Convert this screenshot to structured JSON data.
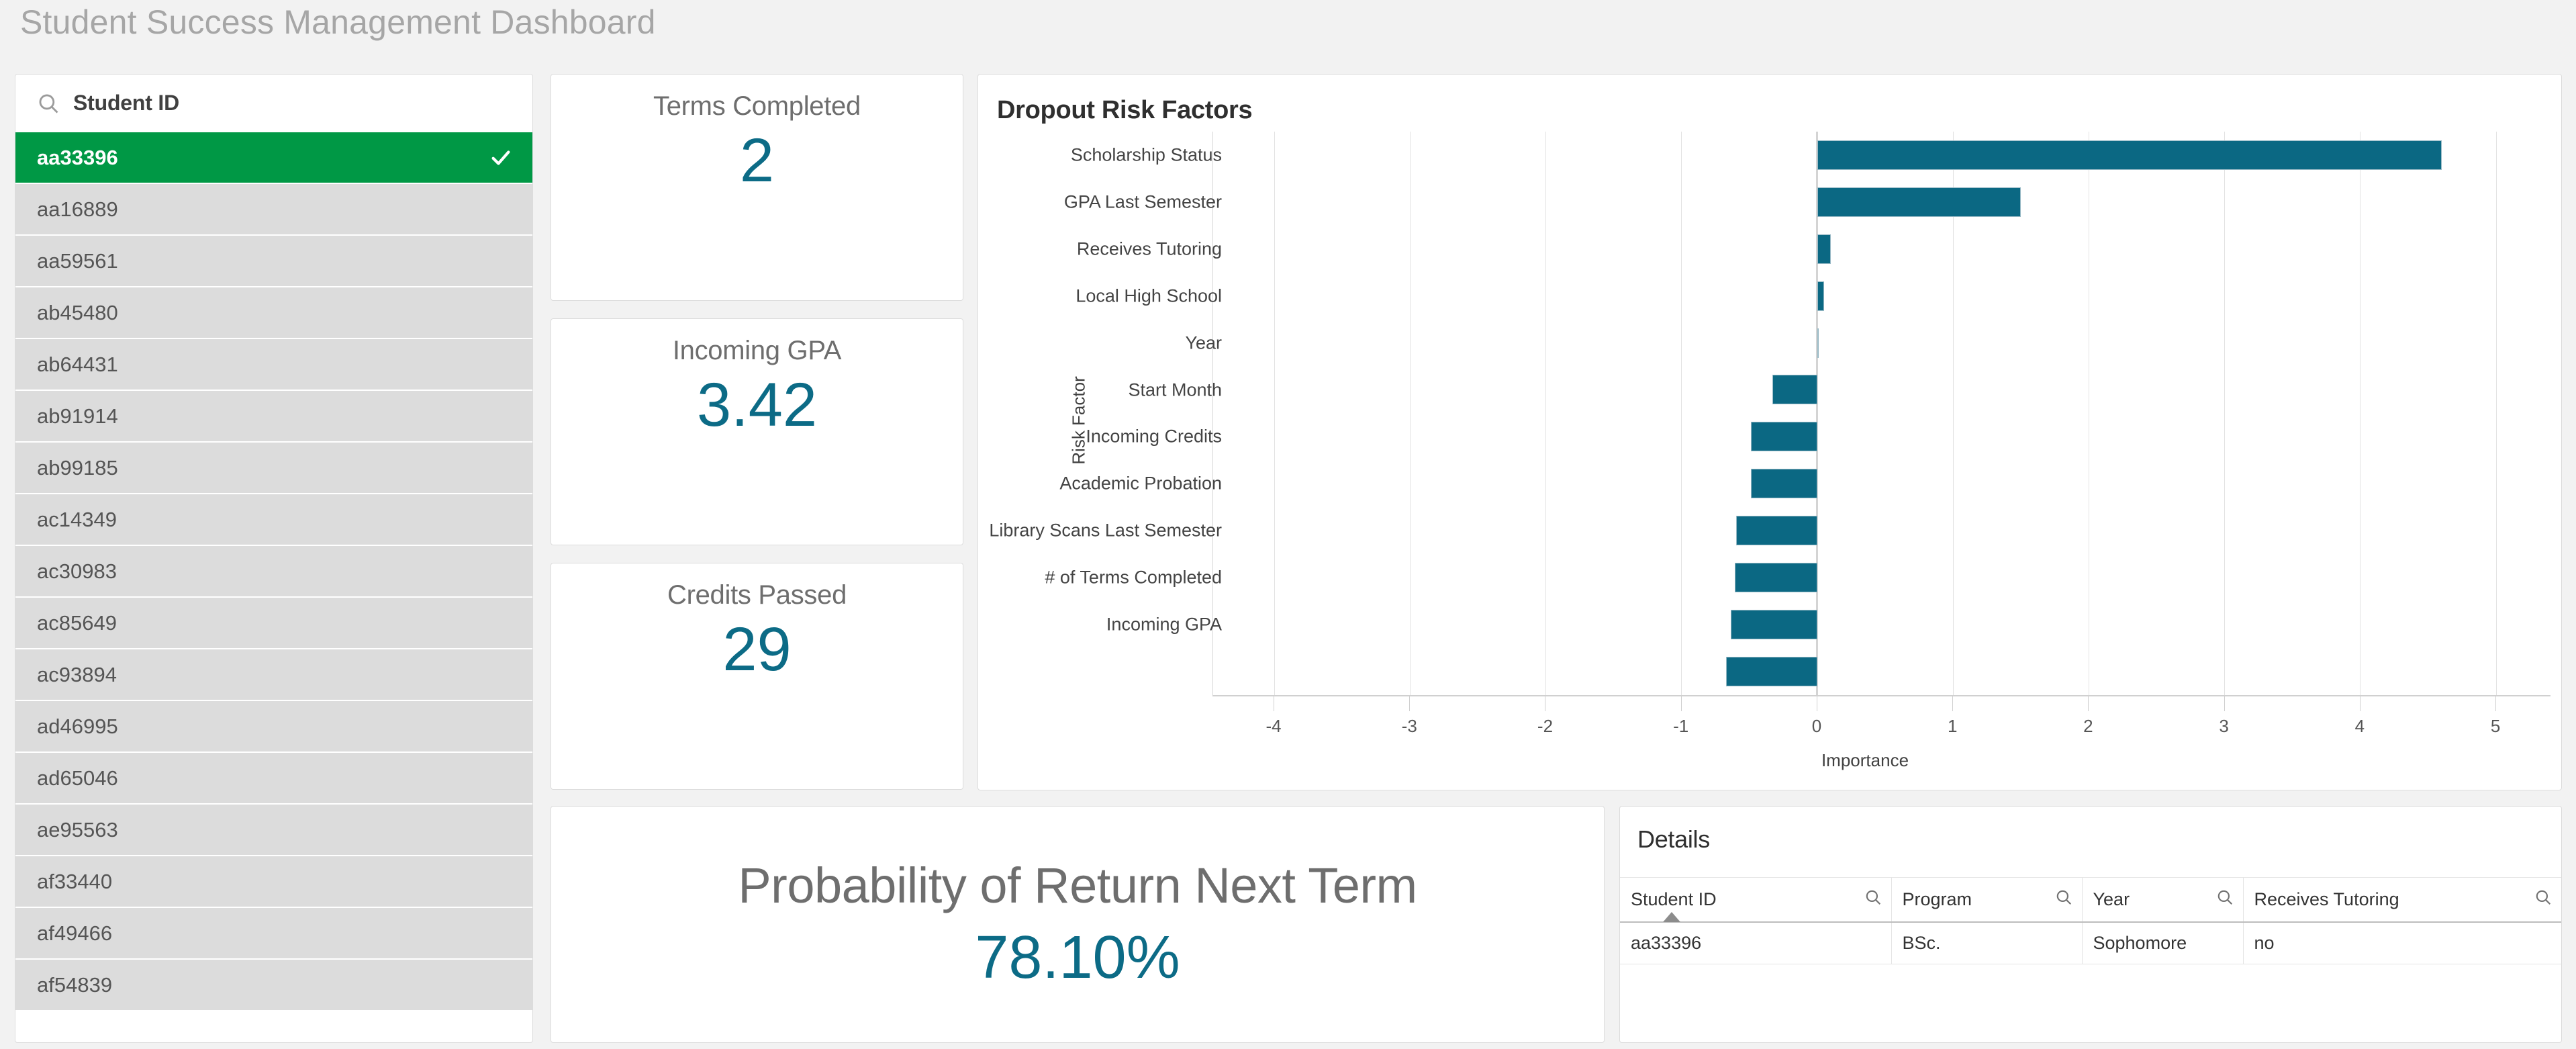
{
  "header": {
    "title": "Student Success Management Dashboard"
  },
  "filter": {
    "search_label": "Student ID",
    "search_icon": "search-icon",
    "check_icon": "check-icon",
    "items": [
      {
        "id": "aa33396",
        "selected": true
      },
      {
        "id": "aa16889",
        "selected": false
      },
      {
        "id": "aa59561",
        "selected": false
      },
      {
        "id": "ab45480",
        "selected": false
      },
      {
        "id": "ab64431",
        "selected": false
      },
      {
        "id": "ab91914",
        "selected": false
      },
      {
        "id": "ab99185",
        "selected": false
      },
      {
        "id": "ac14349",
        "selected": false
      },
      {
        "id": "ac30983",
        "selected": false
      },
      {
        "id": "ac85649",
        "selected": false
      },
      {
        "id": "ac93894",
        "selected": false
      },
      {
        "id": "ad46995",
        "selected": false
      },
      {
        "id": "ad65046",
        "selected": false
      },
      {
        "id": "ae95563",
        "selected": false
      },
      {
        "id": "af33440",
        "selected": false
      },
      {
        "id": "af49466",
        "selected": false
      },
      {
        "id": "af54839",
        "selected": false
      }
    ]
  },
  "kpis": [
    {
      "title": "Terms Completed",
      "value": "2"
    },
    {
      "title": "Incoming GPA",
      "value": "3.42"
    },
    {
      "title": "Credits Passed",
      "value": "29"
    }
  ],
  "probability": {
    "title": "Probability of Return Next Term",
    "value": "78.10%"
  },
  "details": {
    "title": "Details",
    "search_icon": "search-icon",
    "sort_icon": "sort-ascending-icon",
    "columns": [
      "Student ID",
      "Program",
      "Year",
      "Receives Tutoring"
    ],
    "rows": [
      [
        "aa33396",
        "BSc.",
        "Sophomore",
        "no"
      ]
    ]
  },
  "colors": {
    "accent_teal": "#0b6883",
    "selection_green": "#009845",
    "title_gray": "#a6a6a6",
    "row_gray": "#dcdcdc"
  },
  "chart_data": {
    "type": "bar",
    "orientation": "horizontal",
    "title": "Dropout Risk Factors",
    "xlabel": "Importance",
    "ylabel": "Risk Factor",
    "xlim": [
      -4.45,
      5.4
    ],
    "xticks": [
      -4,
      -3,
      -2,
      -1,
      0,
      1,
      2,
      3,
      4,
      5
    ],
    "xticklabels": [
      "-4",
      "-3",
      "-2",
      "-1",
      "0",
      "1",
      "2",
      "3",
      "4",
      "5"
    ],
    "grid": true,
    "legend": "none",
    "bar_color": "#0b6883",
    "categories": [
      "Scholarship Status",
      "GPA Last Semester",
      "Receives Tutoring",
      "Local High School",
      "Year",
      "Start Month",
      "Incoming Credits",
      "Academic Probation",
      "Library Scans Last Semester",
      "# of Terms Completed",
      "Incoming GPA",
      ""
    ],
    "values": [
      4.6,
      1.5,
      0.1,
      0.05,
      0.0,
      -0.33,
      -0.49,
      -0.49,
      -0.6,
      -0.61,
      -0.64,
      -0.67
    ]
  }
}
